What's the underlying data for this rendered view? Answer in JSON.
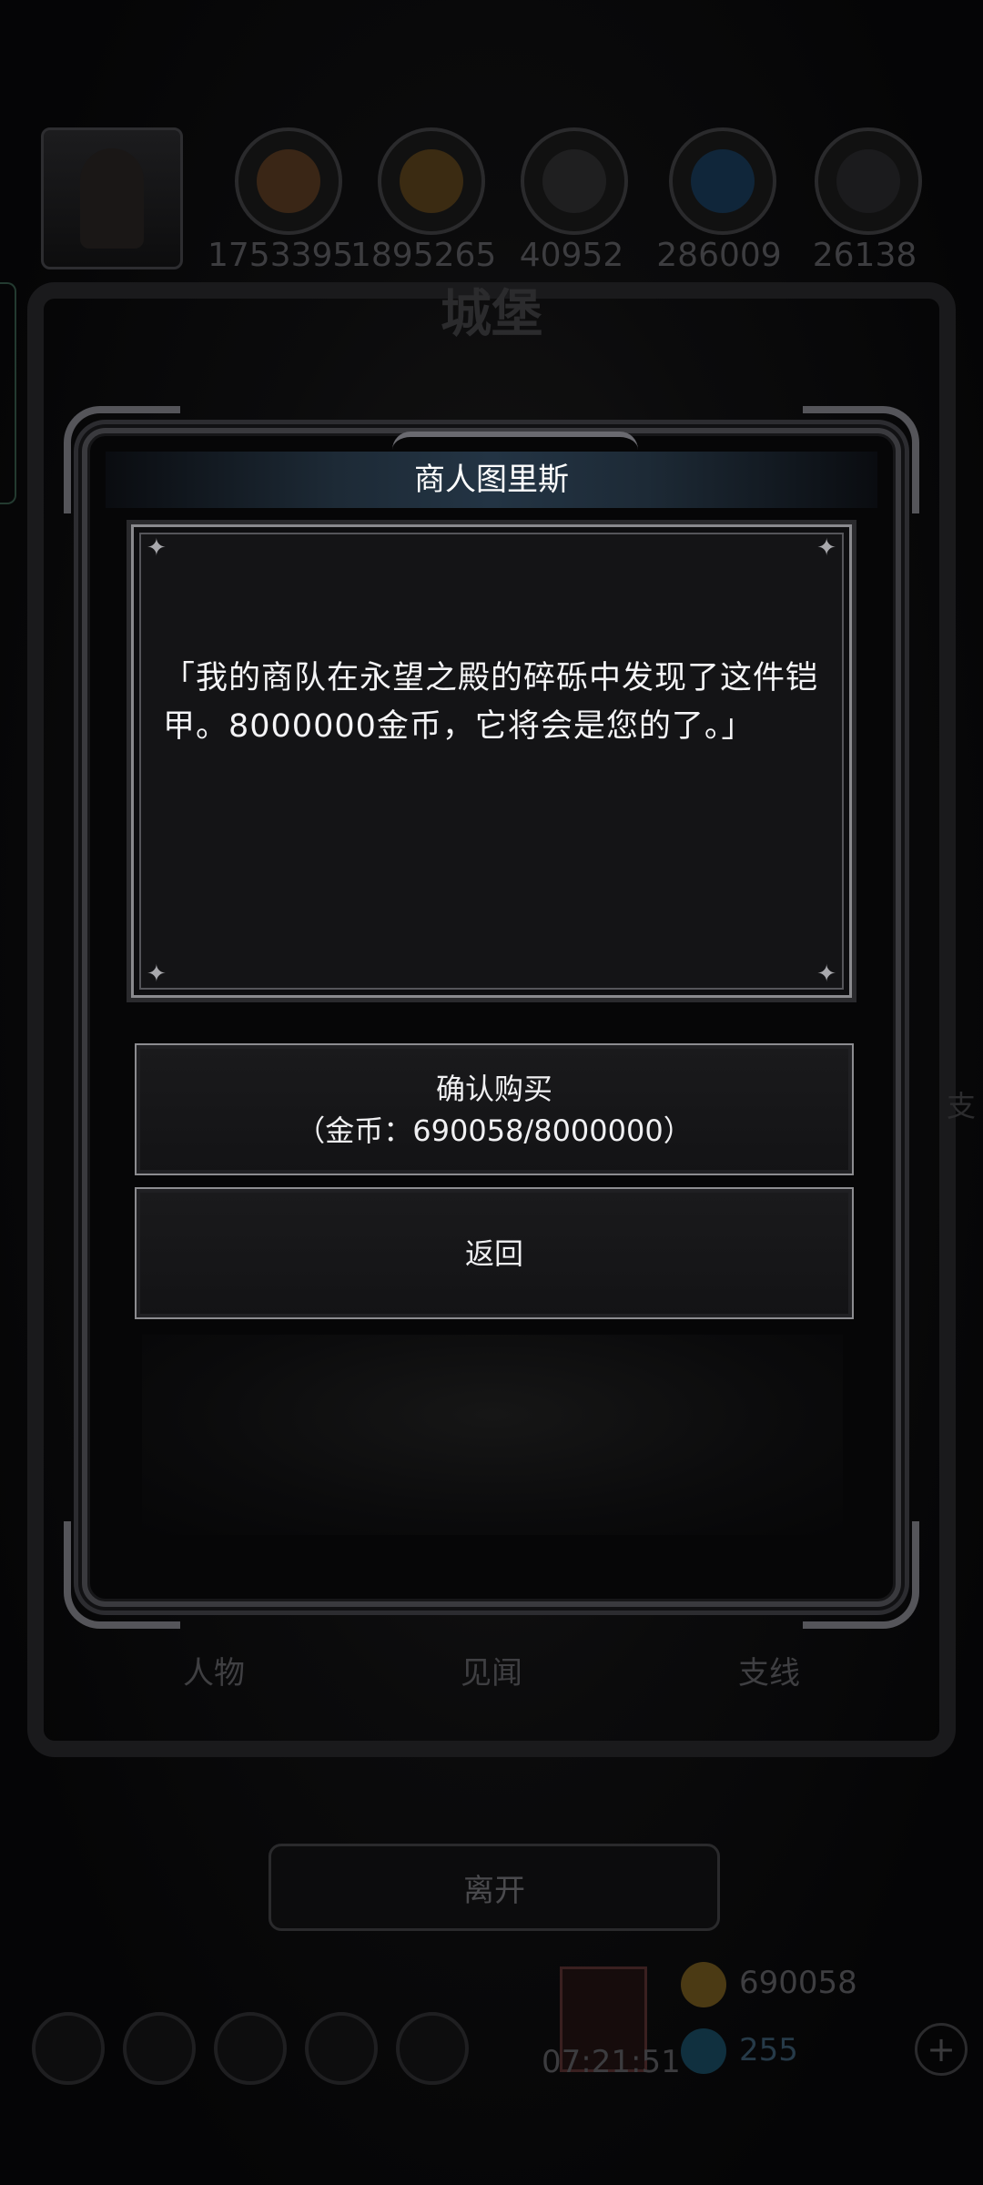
{
  "resources": {
    "values": [
      "1753395",
      "1895265",
      "40952",
      "286009",
      "26138"
    ]
  },
  "castle": {
    "title": "城堡"
  },
  "bottom_tabs": [
    "人物",
    "见闻",
    "支线"
  ],
  "leave_label": "离开",
  "status": {
    "timer": "07:21:51",
    "gold": "690058",
    "gems": "255"
  },
  "side_hint": "支",
  "dialog": {
    "title": "商人图里斯",
    "message": "「我的商队在永望之殿的碎砾中发现了这件铠甲。8000000金币，它将会是您的了。」",
    "confirm_label": "确认购买",
    "confirm_cost": "（金币：690058/8000000）",
    "back_label": "返回"
  }
}
